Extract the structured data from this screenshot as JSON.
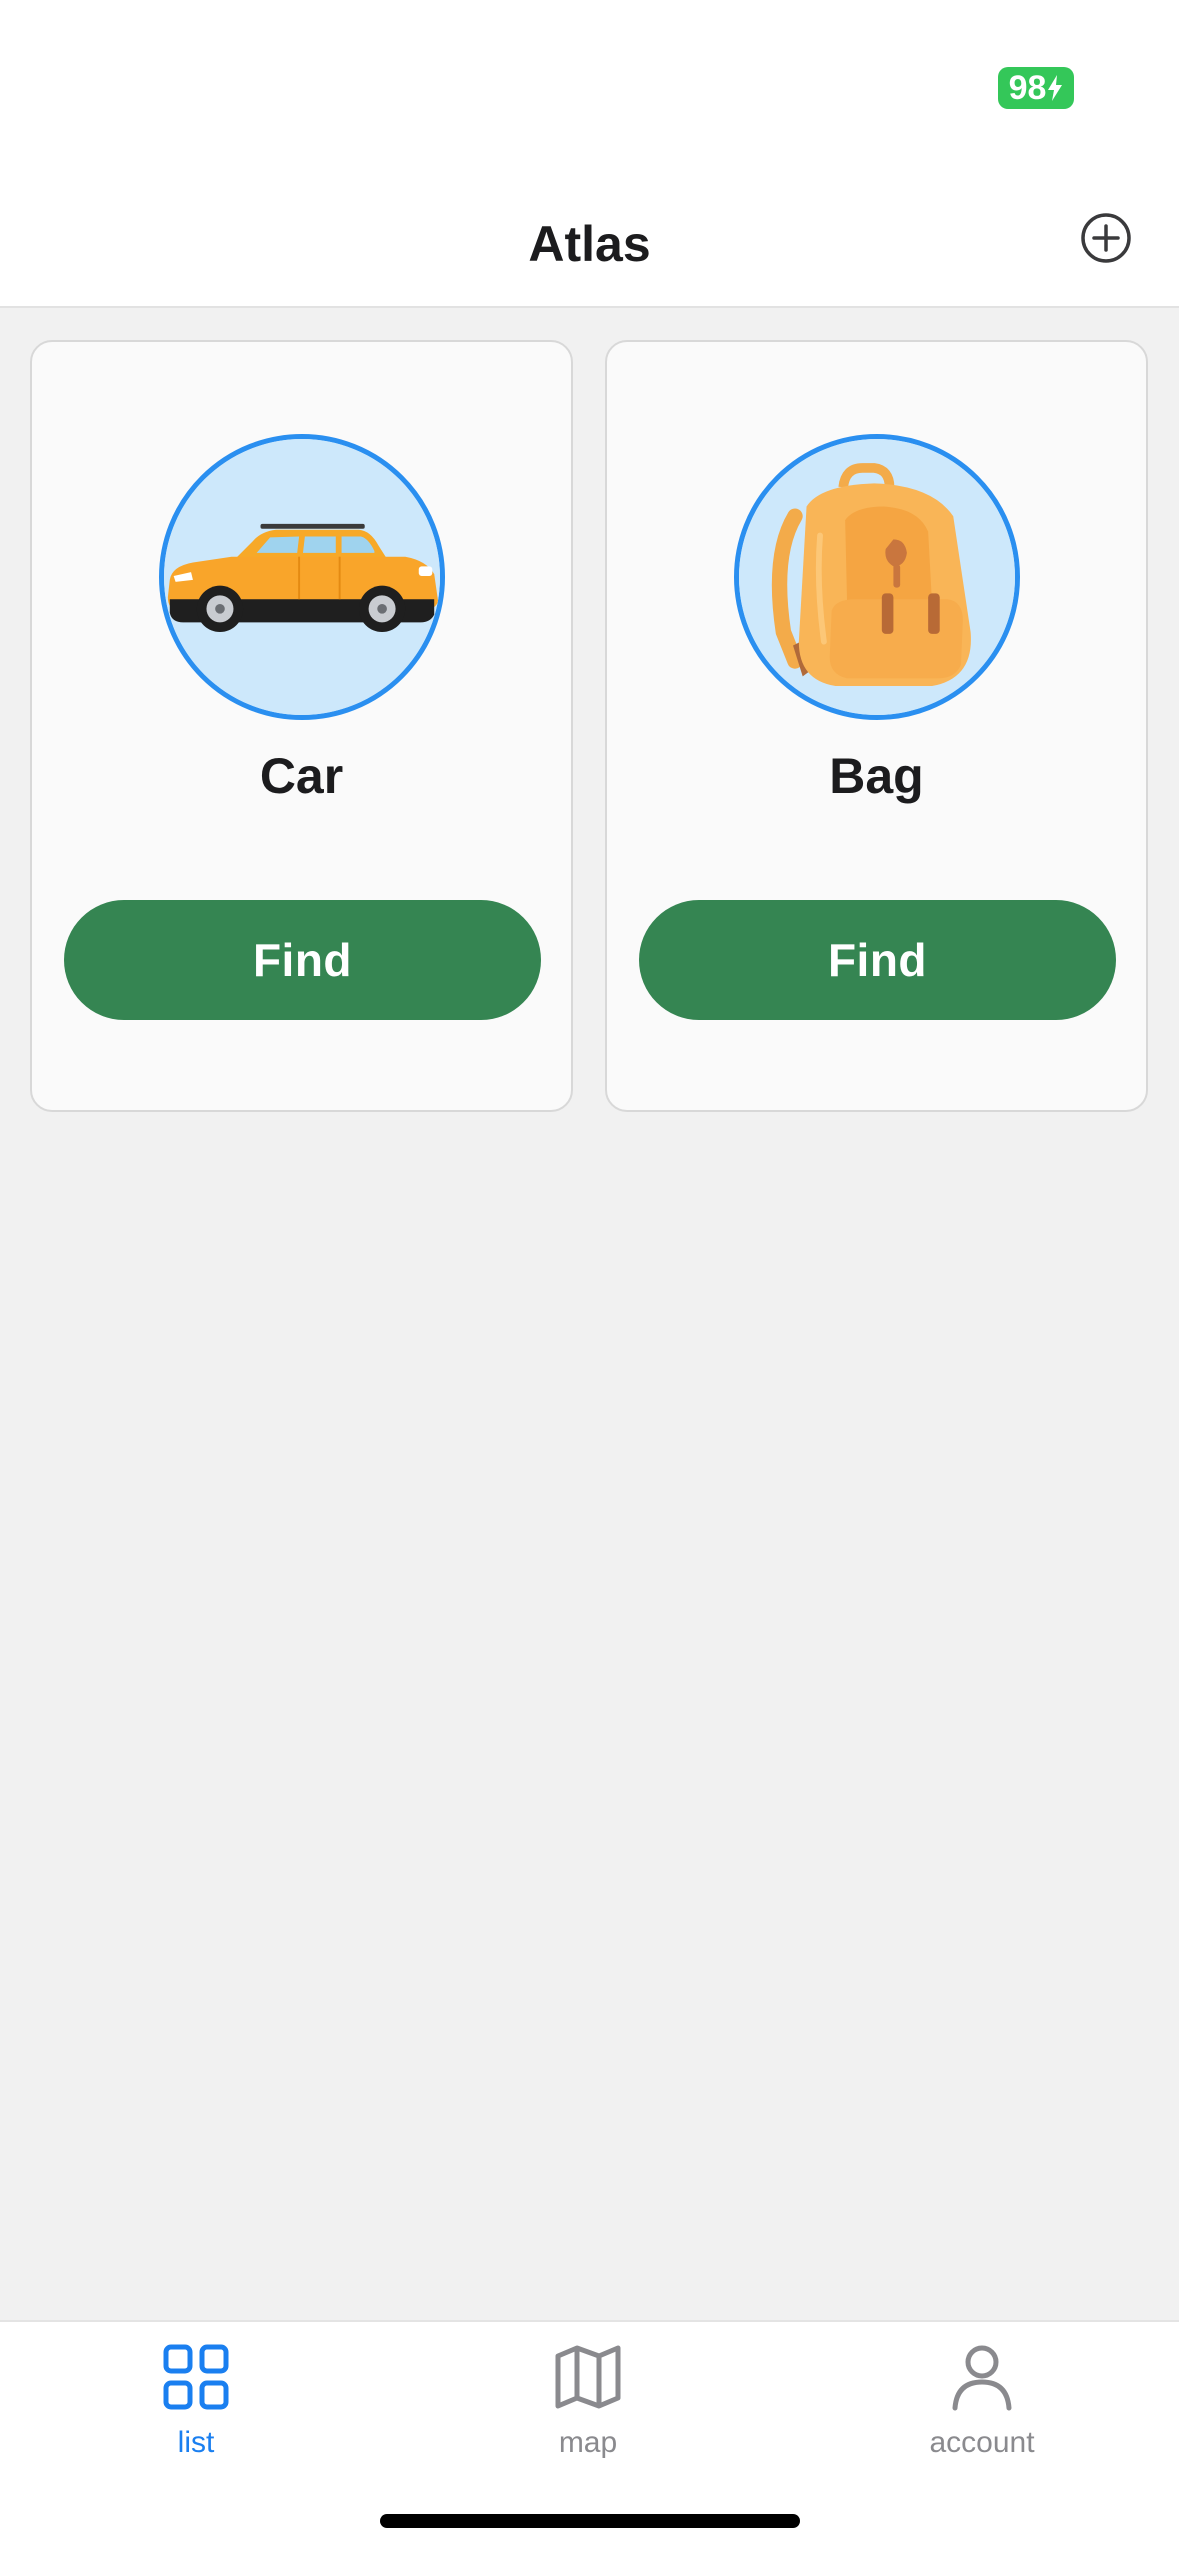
{
  "status_bar": {
    "battery_level": "98",
    "battery_color": "#34c759"
  },
  "header": {
    "title": "Atlas",
    "add_icon": "plus-circle-icon"
  },
  "items": [
    {
      "label": "Car",
      "image": "car-image",
      "button_label": "Find"
    },
    {
      "label": "Bag",
      "image": "backpack-image",
      "button_label": "Find"
    }
  ],
  "tab_bar": {
    "tabs": [
      {
        "label": "list",
        "icon": "grid-icon",
        "active": true
      },
      {
        "label": "map",
        "icon": "map-icon",
        "active": false
      },
      {
        "label": "account",
        "icon": "person-icon",
        "active": false
      }
    ]
  },
  "colors": {
    "accent": "#1a7ff0",
    "button_green": "#358552",
    "avatar_border": "#2a8ff0",
    "avatar_bg": "#cde8fb",
    "background": "#f1f1f1"
  }
}
